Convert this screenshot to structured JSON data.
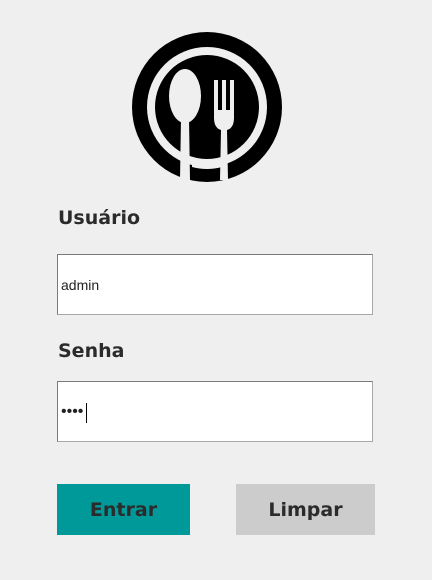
{
  "logo": {
    "icon": "spoon-fork-plate-icon",
    "color": "#000000"
  },
  "login_form": {
    "username": {
      "label": "Usuário",
      "value": "admin"
    },
    "password": {
      "label": "Senha",
      "value": "abcd"
    }
  },
  "buttons": {
    "enter_label": "Entrar",
    "clear_label": "Limpar"
  },
  "colors": {
    "background": "#efefef",
    "enter_button": "#009999",
    "clear_button": "#cccccc"
  }
}
